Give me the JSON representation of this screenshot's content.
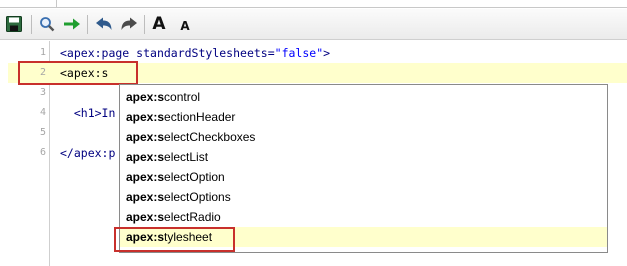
{
  "toolbar": {
    "buttons": [
      {
        "name": "save-icon",
        "tooltip": ""
      },
      {
        "name": "search-icon",
        "tooltip": ""
      },
      {
        "name": "goto-arrow-icon",
        "tooltip": ""
      },
      {
        "name": "undo-icon",
        "tooltip": ""
      },
      {
        "name": "redo-icon",
        "tooltip": ""
      }
    ],
    "font_larger_label": "A",
    "font_smaller_label": "A",
    "colors": {
      "save": "#2d6a3e",
      "search": "#3a6fb0",
      "arrow": "#1f9e2f",
      "undo": "#2f5a8c"
    }
  },
  "editor": {
    "lines": [
      {
        "number": "1",
        "parts": [
          {
            "t": "<apex:page ",
            "c": "tag"
          },
          {
            "t": "standardStylesheets=",
            "c": "attr"
          },
          {
            "t": "\"false\"",
            "c": "str"
          },
          {
            "t": ">",
            "c": "tag"
          }
        ]
      },
      {
        "number": "2",
        "parts": [
          {
            "t": "<apex:s",
            "c": "hl"
          }
        ],
        "active": true
      },
      {
        "number": "3",
        "parts": []
      },
      {
        "number": "4",
        "parts": [
          {
            "t": "  <h1>In",
            "c": "tag"
          }
        ]
      },
      {
        "number": "5",
        "parts": []
      },
      {
        "number": "6",
        "parts": [
          {
            "t": "</apex:p",
            "c": "tag"
          }
        ]
      }
    ],
    "active_line_color": "#ffffcc",
    "highlight_color": "#c8302c"
  },
  "autocomplete": {
    "prefix": "apex:s",
    "items": [
      {
        "bold": "apex:s",
        "rest": "control"
      },
      {
        "bold": "apex:s",
        "rest": "ectionHeader"
      },
      {
        "bold": "apex:s",
        "rest": "electCheckboxes"
      },
      {
        "bold": "apex:s",
        "rest": "electList"
      },
      {
        "bold": "apex:s",
        "rest": "electOption"
      },
      {
        "bold": "apex:s",
        "rest": "electOptions"
      },
      {
        "bold": "apex:s",
        "rest": "electRadio"
      },
      {
        "bold": "apex:s",
        "rest": "tylesheet",
        "selected": true
      }
    ]
  }
}
